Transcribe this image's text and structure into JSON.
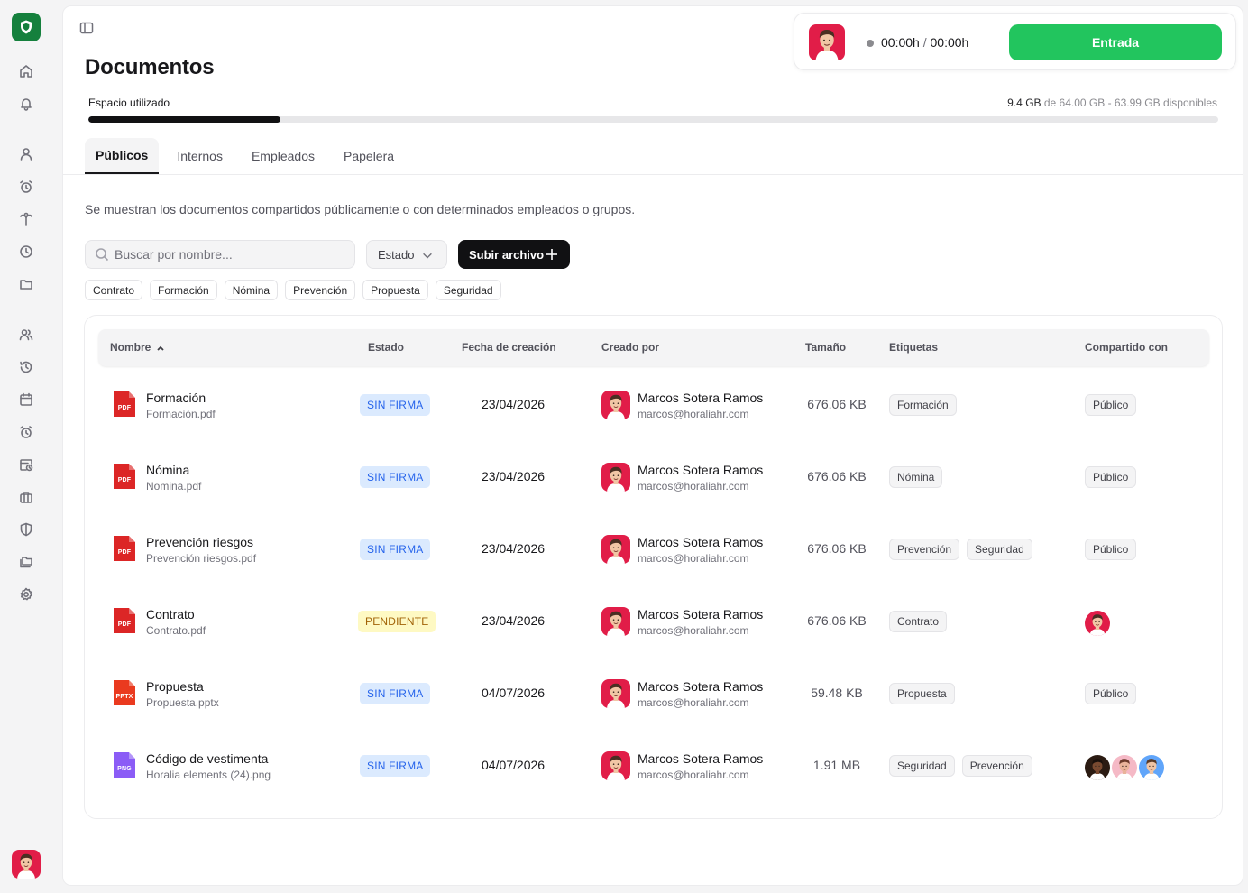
{
  "colors": {
    "brand": "#15803d",
    "entry": "#22c55e",
    "avatar_bg": "#e11d48",
    "sin_firma_bg": "#dbeafe",
    "pendiente_bg": "#fef9c3"
  },
  "sidebar": {
    "icons": [
      "home-icon",
      "bell-icon",
      "user-icon",
      "alarm-icon",
      "palm-tree-icon",
      "clock-icon",
      "folder-icon",
      "users-icon",
      "history-icon",
      "calendar-icon",
      "alarm-clock-icon",
      "calendar-clock-icon",
      "briefcase-icon",
      "shield-icon",
      "folders-icon",
      "gear-icon"
    ]
  },
  "header": {
    "title": "Documentos",
    "clock": {
      "worked": "00:00h",
      "separator": "/",
      "total": "00:00h",
      "entry_label": "Entrada"
    }
  },
  "storage": {
    "label": "Espacio utilizado",
    "used": "9.4 GB",
    "detail": "de 64.00 GB - 63.99 GB disponibles",
    "fraction": 0.17
  },
  "tabs": [
    {
      "label": "Públicos",
      "active": true
    },
    {
      "label": "Internos",
      "active": false
    },
    {
      "label": "Empleados",
      "active": false
    },
    {
      "label": "Papelera",
      "active": false
    }
  ],
  "description": "Se muestran los documentos compartidos públicamente o con determinados empleados o grupos.",
  "toolbar": {
    "search_placeholder": "Buscar por nombre...",
    "estado_label": "Estado",
    "upload_label": "Subir archivo"
  },
  "filter_chips": [
    "Contrato",
    "Formación",
    "Nómina",
    "Prevención",
    "Propuesta",
    "Seguridad"
  ],
  "table": {
    "columns": {
      "name": "Nombre",
      "status": "Estado",
      "created": "Fecha de creación",
      "creator": "Creado por",
      "size": "Tamaño",
      "tags": "Etiquetas",
      "shared": "Compartido con"
    },
    "rows": [
      {
        "name": "Formación",
        "file": "Formación.pdf",
        "type": "PDF",
        "status": "SIN FIRMA",
        "date": "23/04/2026",
        "creator": "Marcos Sotera Ramos",
        "email": "marcos@horaliahr.com",
        "size": "676.06 KB",
        "tags": [
          "Formación"
        ],
        "shared": "Público"
      },
      {
        "name": "Nómina",
        "file": "Nomina.pdf",
        "type": "PDF",
        "status": "SIN FIRMA",
        "date": "23/04/2026",
        "creator": "Marcos Sotera Ramos",
        "email": "marcos@horaliahr.com",
        "size": "676.06 KB",
        "tags": [
          "Nómina"
        ],
        "shared": "Público"
      },
      {
        "name": "Prevención riesgos",
        "file": "Prevención riesgos.pdf",
        "type": "PDF",
        "status": "SIN FIRMA",
        "date": "23/04/2026",
        "creator": "Marcos Sotera Ramos",
        "email": "marcos@horaliahr.com",
        "size": "676.06 KB",
        "tags": [
          "Prevención",
          "Seguridad"
        ],
        "shared": "Público"
      },
      {
        "name": "Contrato",
        "file": "Contrato.pdf",
        "type": "PDF",
        "status": "PENDIENTE",
        "date": "23/04/2026",
        "creator": "Marcos Sotera Ramos",
        "email": "marcos@horaliahr.com",
        "size": "676.06 KB",
        "tags": [
          "Contrato"
        ],
        "shared": ""
      },
      {
        "name": "Propuesta",
        "file": "Propuesta.pptx",
        "type": "PPTX",
        "status": "SIN FIRMA",
        "date": "04/07/2026",
        "creator": "Marcos Sotera Ramos",
        "email": "marcos@horaliahr.com",
        "size": "59.48 KB",
        "tags": [
          "Propuesta"
        ],
        "shared": "Público"
      },
      {
        "name": "Código de vestimenta",
        "file": "Horalia elements (24).png",
        "type": "PNG",
        "status": "SIN FIRMA",
        "date": "04/07/2026",
        "creator": "Marcos Sotera Ramos",
        "email": "marcos@horaliahr.com",
        "size": "1.91 MB",
        "tags": [
          "Seguridad",
          "Prevención"
        ],
        "shared": ""
      }
    ]
  }
}
